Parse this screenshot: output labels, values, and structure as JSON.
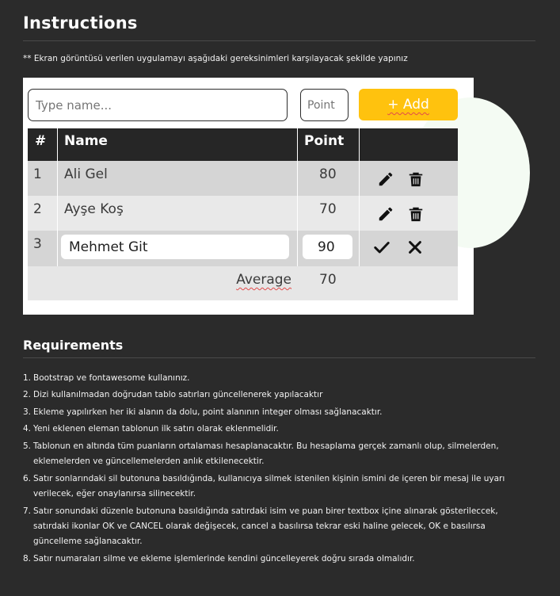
{
  "page": {
    "title": "Instructions",
    "intro": "** Ekran görüntüsü verilen uygulamayı aşağıdaki gereksinimleri karşılayacak şekilde yapınız"
  },
  "form": {
    "name_placeholder": "Type name...",
    "point_placeholder": "Point",
    "add_label": "+ Add"
  },
  "table": {
    "headers": [
      "#",
      "Name",
      "Point",
      ""
    ],
    "rows": [
      {
        "num": "1",
        "name": "Ali Gel",
        "point": "80",
        "mode": "view"
      },
      {
        "num": "2",
        "name": "Ayşe Koş",
        "point": "70",
        "mode": "view"
      },
      {
        "num": "3",
        "name": "Mehmet Git",
        "point": "90",
        "mode": "edit"
      }
    ],
    "average_label": "Average",
    "average_value": "70"
  },
  "icons": {
    "edit": "pencil-icon",
    "delete": "trash-icon",
    "ok": "check-icon",
    "cancel": "times-icon"
  },
  "requirements": {
    "title": "Requirements",
    "items": [
      {
        "num": "1.",
        "text": "Bootstrap ve fontawesome kullanınız."
      },
      {
        "num": "2.",
        "text": "Dizi kullanılmadan doğrudan tablo satırları güncellenerek yapılacaktır"
      },
      {
        "num": "3.",
        "text": "Ekleme yapılırken her iki alanın da dolu, point alanının integer olması sağlanacaktır."
      },
      {
        "num": "4.",
        "text": "Yeni eklenen eleman tablonun ilk satırı olarak eklenmelidir."
      },
      {
        "num": "5.",
        "text": "Tablonun en altında tüm puanların ortalaması hesaplanacaktır. Bu hesaplama gerçek zamanlı olup, silmelerden, eklemelerden ve güncellemelerden anlık etkilenecektir."
      },
      {
        "num": "6.",
        "text": "Satır sonlarındaki sil butonuna basıldığında, kullanıcıya silmek istenilen kişinin ismini de içeren bir mesaj ile uyarı verilecek, eğer onaylanırsa silinecektir."
      },
      {
        "num": "7.",
        "text": "Satır sonundaki düzenle butonuna basıldığında satırdaki isim ve puan birer textbox içine alınarak gösterileccek, satırdaki ikonlar OK ve CANCEL olarak değişecek, cancel a basılırsa tekrar eski haline gelecek, OK e basılırsa güncelleme sağlanacaktır."
      },
      {
        "num": "8.",
        "text": "Satır numaraları silme ve ekleme işlemlerinde kendini güncelleyerek doğru sırada olmalıdır."
      }
    ]
  }
}
